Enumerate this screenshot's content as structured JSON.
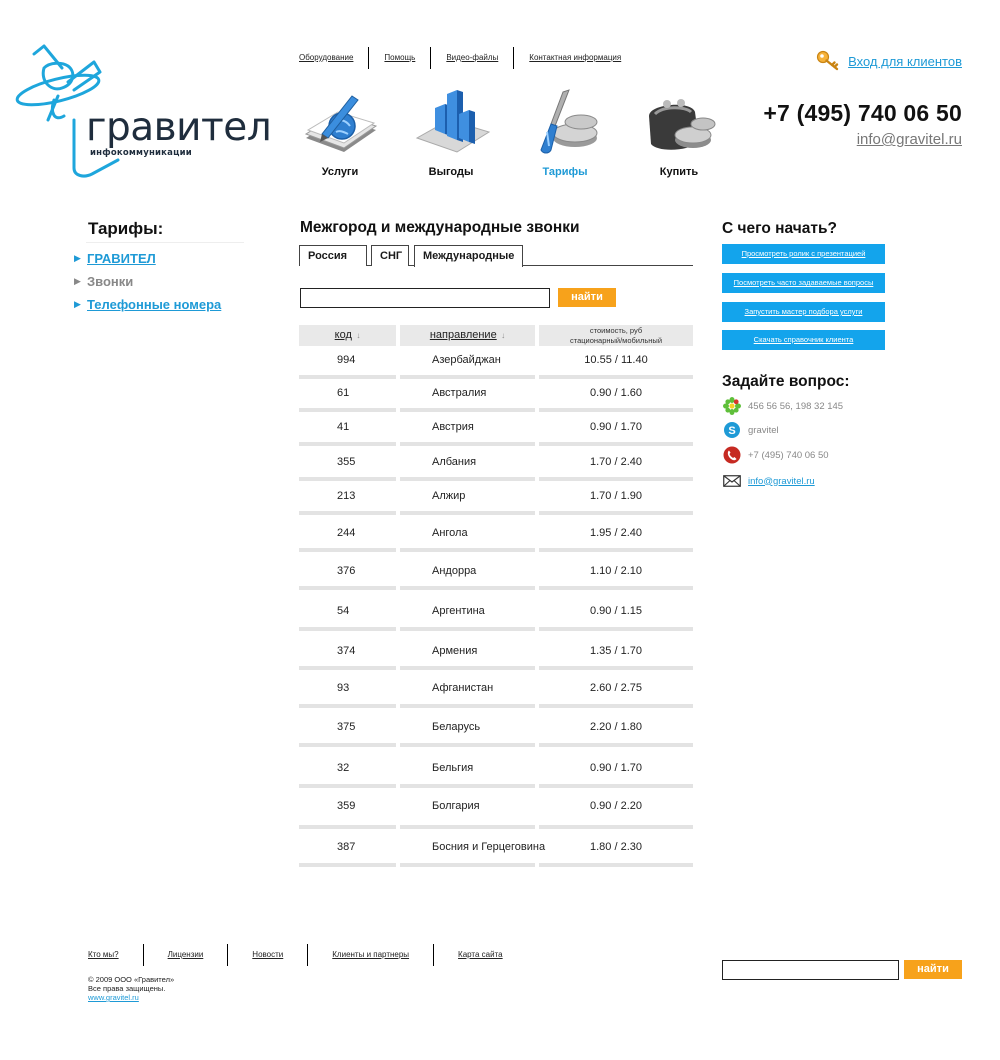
{
  "brand": {
    "name": "гравител",
    "subtitle": "инфокоммуникации",
    "accent_color": "#1e9ad6",
    "button_color": "#f7a21b",
    "sidebar_button_color": "#13a4ec"
  },
  "top_links": [
    "Оборудование",
    "Помощь",
    "Видео-файлы",
    "Контактная информация"
  ],
  "login": {
    "icon": "key-icon",
    "label": "Вход для клиентов"
  },
  "contacts_top": {
    "phone": "+7 (495) 740 06 50",
    "email": "info@gravitel.ru"
  },
  "nav": [
    {
      "label": "Услуги",
      "icon": "book-globe-icon",
      "active": false
    },
    {
      "label": "Выгоды",
      "icon": "bar-chart-icon",
      "active": false
    },
    {
      "label": "Тарифы",
      "icon": "screwdriver-coins-icon",
      "active": true
    },
    {
      "label": "Купить",
      "icon": "wallet-coins-icon",
      "active": false
    }
  ],
  "sidebar": {
    "title": "Тарифы:",
    "items": [
      {
        "label": "ГРАВИТЕЛ",
        "link": true
      },
      {
        "label": "Звонки",
        "link": false
      },
      {
        "label": "Телефонные номера",
        "link": true
      }
    ]
  },
  "content": {
    "title": "Межгород и международные звонки",
    "tabs": [
      "Россия",
      "СНГ",
      "Международные"
    ],
    "active_tab": "Международные",
    "search": {
      "value": "",
      "button": "найти"
    }
  },
  "rates_table": {
    "headers": {
      "code": "код",
      "direction": "направление",
      "price_line1": "стоимость, руб",
      "price_line2": "стационарный/мобильный"
    },
    "rows": [
      {
        "code": "994",
        "direction": "Азербайджан",
        "price": "10.55 / 11.40"
      },
      {
        "code": "61",
        "direction": "Австралия",
        "price": "0.90 / 1.60"
      },
      {
        "code": "41",
        "direction": "Австрия",
        "price": "0.90 / 1.70"
      },
      {
        "code": "355",
        "direction": "Албания",
        "price": "1.70 / 2.40"
      },
      {
        "code": "213",
        "direction": "Алжир",
        "price": "1.70 / 1.90"
      },
      {
        "code": "244",
        "direction": "Ангола",
        "price": "1.95 / 2.40"
      },
      {
        "code": "376",
        "direction": "Андорра",
        "price": "1.10 / 2.10"
      },
      {
        "code": "54",
        "direction": "Аргентина",
        "price": "0.90 / 1.15"
      },
      {
        "code": "374",
        "direction": "Армения",
        "price": "1.35 / 1.70"
      },
      {
        "code": "93",
        "direction": "Афганистан",
        "price": "2.60 / 2.75"
      },
      {
        "code": "375",
        "direction": "Беларусь",
        "price": "2.20 / 1.80"
      },
      {
        "code": "32",
        "direction": "Бельгия",
        "price": "0.90 / 1.70"
      },
      {
        "code": "359",
        "direction": "Болгария",
        "price": "0.90 / 2.20"
      },
      {
        "code": "387",
        "direction": "Босния и Герцеговина",
        "price": "1.80 / 2.30"
      }
    ]
  },
  "right": {
    "title": "С чего начать?",
    "buttons": [
      "Просмотреть ролик с презентацией",
      "Посмотреть часто задаваемые вопросы",
      "Запустить мастер подбора услуги",
      "Скачать справочник клиента"
    ],
    "ask_title": "Задайте вопрос:",
    "contacts": [
      {
        "icon": "icq-icon",
        "text": "456 56 56, 198 32 145"
      },
      {
        "icon": "skype-icon",
        "text": "gravitel"
      },
      {
        "icon": "phone-icon",
        "text": "+7 (495) 740 06 50"
      },
      {
        "icon": "envelope-icon",
        "text": "info@gravitel.ru"
      }
    ]
  },
  "footer": {
    "links": [
      "Кто мы?",
      "Лицензии",
      "Новости",
      "Клиенты и партнеры",
      "Карта сайта"
    ],
    "copyright_line1": "© 2009 ООО «Гравител»",
    "copyright_line2": "Все права защищены.",
    "site_url": "www.gravitel.ru",
    "search": {
      "value": "",
      "button": "найти"
    }
  }
}
